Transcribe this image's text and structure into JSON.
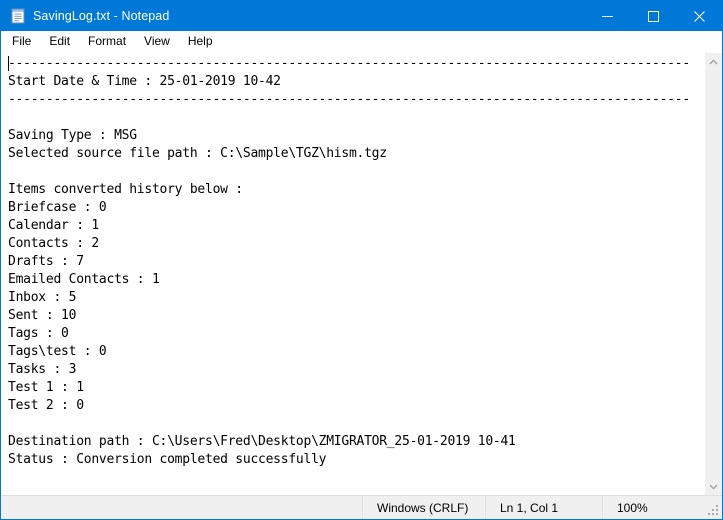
{
  "window": {
    "title": "SavingLog.txt - Notepad",
    "icon": "notepad-icon",
    "accent_color": "#0078d7",
    "titlebar_text_color": "#ffffff",
    "controls": {
      "minimize": "Minimize",
      "maximize": "Maximize",
      "close": "Close"
    }
  },
  "menubar": {
    "items": [
      {
        "label": "File"
      },
      {
        "label": "Edit"
      },
      {
        "label": "Format"
      },
      {
        "label": "View"
      },
      {
        "label": "Help"
      }
    ]
  },
  "document": {
    "caret": {
      "visible": true,
      "line": 1,
      "column": 1
    },
    "lines": [
      "------------------------------------------------------------------------------------------",
      "Start Date & Time : 25-01-2019 10-42",
      "------------------------------------------------------------------------------------------",
      "",
      "Saving Type : MSG",
      "Selected source file path : C:\\Sample\\TGZ\\hism.tgz",
      "",
      "Items converted history below :",
      "Briefcase : 0",
      "Calendar : 1",
      "Contacts : 2",
      "Drafts : 7",
      "Emailed Contacts : 1",
      "Inbox : 5",
      "Sent : 10",
      "Tags : 0",
      "Tags\\test : 0",
      "Tasks : 3",
      "Test 1 : 1",
      "Test 2 : 0",
      "",
      "Destination path : C:\\Users\\Fred\\Desktop\\ZMIGRATOR_25-01-2019 10-41",
      "Status : Conversion completed successfully"
    ]
  },
  "scrollbar": {
    "up_arrow": "chevron-up-icon",
    "down_arrow": "chevron-down-icon"
  },
  "statusbar": {
    "encoding": "Windows (CRLF)",
    "position": "Ln 1, Col 1",
    "zoom": "100%"
  }
}
